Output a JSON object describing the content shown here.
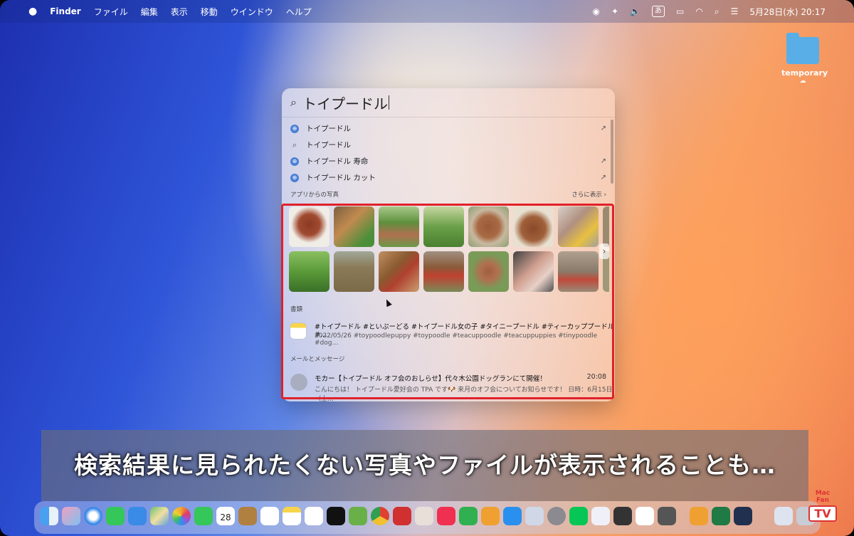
{
  "menubar": {
    "apple_icon": "apple-logo-icon",
    "items": [
      "Finder",
      "ファイル",
      "編集",
      "表示",
      "移動",
      "ウインドウ",
      "ヘルプ"
    ],
    "input_mode": "あ",
    "datetime": "5月28日(水)  20:17"
  },
  "desktop": {
    "folder_label": "temporary"
  },
  "spotlight": {
    "query": "トイプードル",
    "suggestions": [
      {
        "label": "トイプードル",
        "icon": "safari-icon"
      },
      {
        "label": "トイプードル",
        "icon": "search-icon"
      },
      {
        "label": "トイプードル 寿命",
        "icon": "safari-icon"
      },
      {
        "label": "トイプードル カット",
        "icon": "safari-icon"
      }
    ],
    "photos_section": "アプリからの写真",
    "photos_more": "さらに表示 ›",
    "photo_count": 14,
    "docs_section": "書類",
    "doc": {
      "title": "#トイプードル #といぷーどる #トイプードル女の子 #タイニープードル #ティーカッププードル #…",
      "subtitle": "2022/05/26 #toypoodlepuppy #toypoodle #teacuppoodle #teacuppuppies #tinypoodle #dog…"
    },
    "mail_section": "メールとメッセージ",
    "mail": {
      "title": "モカー【トイプードル オフ会のおしらせ】代々木公園ドッグランにて開催！",
      "time": "20:08",
      "subtitle": "こんにちは！ トイプードル愛好会の TPA です🐶 来月のオフ会についてお知らせです！ 日時：6月15日（土..."
    }
  },
  "caption": "検索結果に見られたくない写真やファイルが表示されることも…",
  "dock": {
    "calendar_day": "28"
  },
  "watermark": {
    "top": "Mac Fan",
    "bottom": "TV"
  },
  "colors": {
    "highlight": "#e0212a",
    "accent": "#4a7fd6"
  }
}
